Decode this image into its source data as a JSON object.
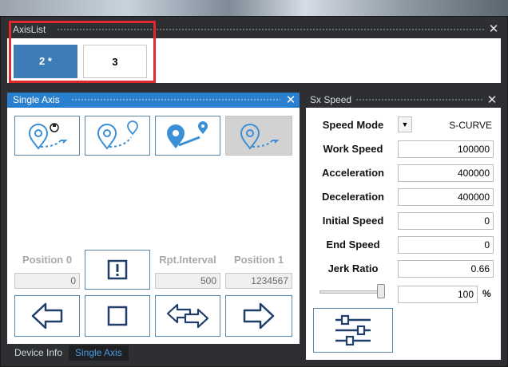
{
  "axis_list": {
    "title": "AxisList",
    "buttons": [
      {
        "label": "2 *",
        "active": true
      },
      {
        "label": "3",
        "active": false
      }
    ]
  },
  "single_axis": {
    "title": "Single Axis",
    "position0_label": "Position 0",
    "position0_value": "0",
    "rpt_interval_label": "Rpt.Interval",
    "rpt_interval_value": "500",
    "position1_label": "Position 1",
    "position1_value": "1234567"
  },
  "bottom_tabs": [
    {
      "label": "Device Info",
      "active": false
    },
    {
      "label": "Single Axis",
      "active": true
    }
  ],
  "sx_speed": {
    "title": "Sx Speed",
    "speed_mode_label": "Speed Mode",
    "speed_mode_value": "S-CURVE",
    "fields": [
      {
        "label": "Work Speed",
        "value": "100000"
      },
      {
        "label": "Acceleration",
        "value": "400000"
      },
      {
        "label": "Deceleration",
        "value": "400000"
      },
      {
        "label": "Initial Speed",
        "value": "0"
      },
      {
        "label": "End Speed",
        "value": "0"
      },
      {
        "label": "Jerk Ratio",
        "value": "0.66"
      }
    ],
    "slider_value": "100",
    "slider_unit": "%",
    "slider_level_pct": 100
  },
  "colors": {
    "accent": "#2a80cf",
    "active_axis": "#3c7db7",
    "highlight": "#e0282e",
    "icon_blue": "#3a8fd6"
  }
}
